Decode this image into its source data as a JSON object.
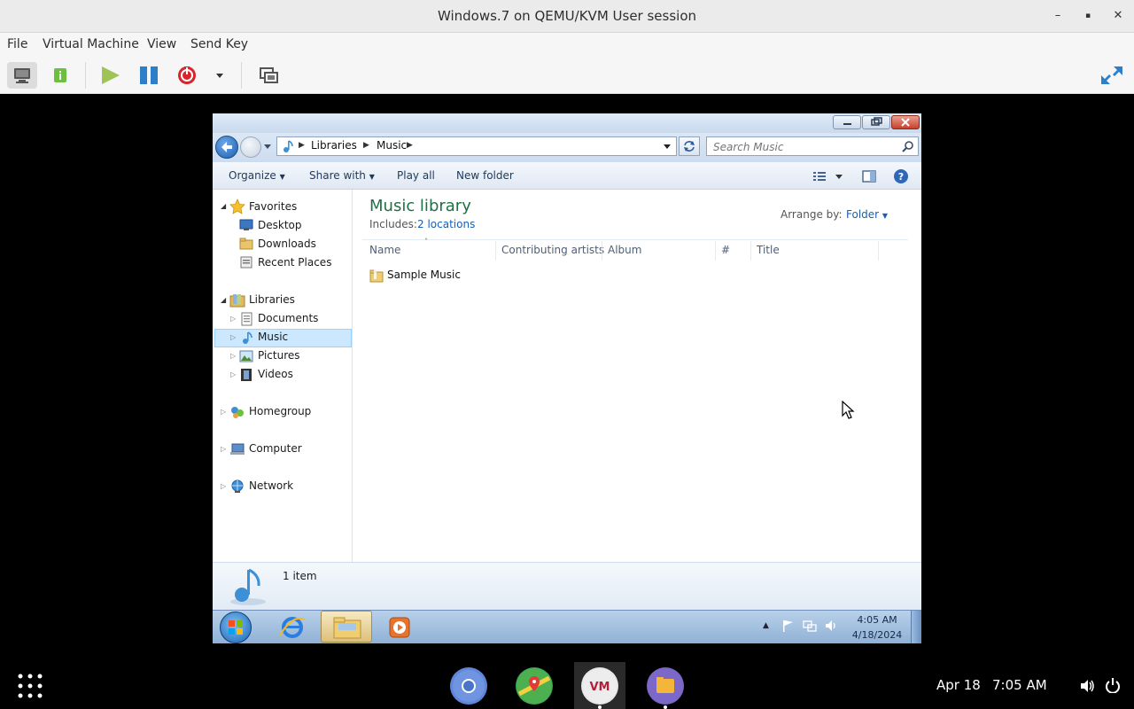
{
  "host": {
    "title": "Windows.7 on QEMU/KVM User session",
    "menu": [
      "File",
      "Virtual Machine",
      "View",
      "Send Key"
    ],
    "window_controls": {
      "minimize": "–",
      "maximize": "▪",
      "close": "✕"
    }
  },
  "explorer": {
    "breadcrumb": [
      "Libraries",
      "Music"
    ],
    "search_placeholder": "Search Music",
    "commands": [
      "Organize",
      "Share with",
      "Play all",
      "New folder"
    ],
    "nav": {
      "favorites_label": "Favorites",
      "favorites": [
        "Desktop",
        "Downloads",
        "Recent Places"
      ],
      "libraries_label": "Libraries",
      "libraries": [
        "Documents",
        "Music",
        "Pictures",
        "Videos"
      ],
      "homegroup": "Homegroup",
      "computer": "Computer",
      "network": "Network",
      "selected": "Music"
    },
    "library_title": "Music library",
    "includes_label": "Includes:",
    "includes_link": "2 locations",
    "arrange_label": "Arrange by:",
    "arrange_value": "Folder",
    "columns": [
      "Name",
      "Contributing artists",
      "Album",
      "#",
      "Title"
    ],
    "items": [
      {
        "name": "Sample Music"
      }
    ],
    "status": "1 item"
  },
  "guest_taskbar": {
    "time": "4:05 AM",
    "date": "4/18/2024"
  },
  "host_panel": {
    "date": "Apr 18",
    "time": "7:05 AM"
  },
  "colors": {
    "accent_title": "#1e7145",
    "link": "#1560b6",
    "selected_bg": "#cce8ff"
  }
}
